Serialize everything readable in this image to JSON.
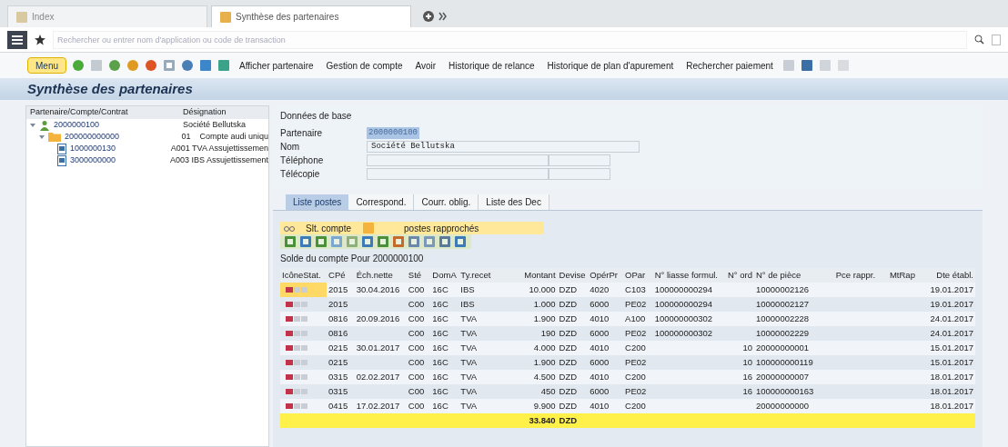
{
  "browser_tabs": [
    {
      "label": "Index",
      "selected": false
    },
    {
      "label": "Synthèse des partenaires",
      "selected": true
    }
  ],
  "search": {
    "placeholder": "Rechercher ou entrer nom d'application ou code de transaction"
  },
  "toolbar": {
    "menu": "Menu",
    "buttons": [
      "Afficher partenaire",
      "Gestion de compte",
      "Avoir",
      "Historique de relance",
      "Historique de plan d'apurement",
      "Rechercher paiement"
    ]
  },
  "title": "Synthèse des partenaires",
  "tree": {
    "columns": [
      "Partenaire/Compte/Contrat",
      "Désignation"
    ],
    "nodes": [
      {
        "kind": "partner",
        "label": "2000000100",
        "designation": "Société Bellutska",
        "expanded": true,
        "children": [
          {
            "kind": "account",
            "label": "200000000000",
            "designation": "01    Compte audi uniqu",
            "expanded": true,
            "children": [
              {
                "kind": "contract",
                "label": "1000000130",
                "designation": "A001 TVA Assujettissemen"
              },
              {
                "kind": "contract",
                "label": "3000000000",
                "designation": "A003 IBS Assujettissement"
              }
            ]
          }
        ]
      }
    ]
  },
  "base_data": {
    "title": "Données de base",
    "fields": [
      {
        "label": "Partenaire",
        "value": "2000000100",
        "kind": "short"
      },
      {
        "label": "Nom",
        "value": "Société Bellutska",
        "kind": "long"
      },
      {
        "label": "Téléphone",
        "kind": "double"
      },
      {
        "label": "Télécopie",
        "kind": "double"
      }
    ]
  },
  "tabs": [
    {
      "label": "Liste postes",
      "selected": true
    },
    {
      "label": "Correspond.",
      "selected": false
    },
    {
      "label": "Courr. oblig.",
      "selected": false
    },
    {
      "label": "Liste des Dec",
      "selected": false
    }
  ],
  "list_toolbar": {
    "view": "Slt. compte",
    "view_2": "postes rapprochés"
  },
  "balance_title": "Solde du compte Pour 2000000100",
  "table": {
    "columns": [
      "IcôneStat.",
      "CPé",
      "Éch.nette",
      "Sté",
      "DomA",
      "Ty.recet",
      "Montant",
      "Devise",
      "OpérPr",
      "OPar",
      "N° liasse formul.",
      "N° ord",
      "N° de pièce",
      "Pce rappr.",
      "MtRap",
      "Dte établ."
    ],
    "rows": [
      {
        "selected": true,
        "cells": [
          "",
          "2015",
          "30.04.2016",
          "C00",
          "16C",
          "IBS",
          "10.000",
          "DZD",
          "4020",
          "C103",
          "100000000294",
          "",
          "10000002126",
          "",
          "",
          "19.01.2017"
        ]
      },
      {
        "selected": false,
        "cells": [
          "",
          "2015",
          "",
          "C00",
          "16C",
          "IBS",
          "1.000",
          "DZD",
          "6000",
          "PE02",
          "100000000294",
          "",
          "10000002127",
          "",
          "",
          "19.01.2017"
        ]
      },
      {
        "selected": false,
        "cells": [
          "",
          "0816",
          "20.09.2016",
          "C00",
          "16C",
          "TVA",
          "1.900",
          "DZD",
          "4010",
          "A100",
          "100000000302",
          "",
          "10000002228",
          "",
          "",
          "24.01.2017"
        ]
      },
      {
        "selected": false,
        "cells": [
          "",
          "0816",
          "",
          "C00",
          "16C",
          "TVA",
          "190",
          "DZD",
          "6000",
          "PE02",
          "100000000302",
          "",
          "10000002229",
          "",
          "",
          "24.01.2017"
        ]
      },
      {
        "selected": false,
        "cells": [
          "",
          "0215",
          "30.01.2017",
          "C00",
          "16C",
          "TVA",
          "4.000",
          "DZD",
          "4010",
          "C200",
          "",
          "10",
          "20000000001",
          "",
          "",
          "15.01.2017"
        ]
      },
      {
        "selected": false,
        "cells": [
          "",
          "0215",
          "",
          "C00",
          "16C",
          "TVA",
          "1.900",
          "DZD",
          "6000",
          "PE02",
          "",
          "10",
          "100000000119",
          "",
          "",
          "15.01.2017"
        ]
      },
      {
        "selected": false,
        "cells": [
          "",
          "0315",
          "02.02.2017",
          "C00",
          "16C",
          "TVA",
          "4.500",
          "DZD",
          "4010",
          "C200",
          "",
          "16",
          "20000000007",
          "",
          "",
          "18.01.2017"
        ]
      },
      {
        "selected": false,
        "cells": [
          "",
          "0315",
          "",
          "C00",
          "16C",
          "TVA",
          "450",
          "DZD",
          "6000",
          "PE02",
          "",
          "16",
          "100000000163",
          "",
          "",
          "18.01.2017"
        ]
      },
      {
        "selected": false,
        "cells": [
          "",
          "0415",
          "17.02.2017",
          "C00",
          "16C",
          "TVA",
          "9.900",
          "DZD",
          "4010",
          "C200",
          "",
          "",
          "20000000000",
          "",
          "",
          "18.01.2017"
        ]
      }
    ],
    "total": {
      "amount": "33.840",
      "currency": "DZD"
    }
  }
}
